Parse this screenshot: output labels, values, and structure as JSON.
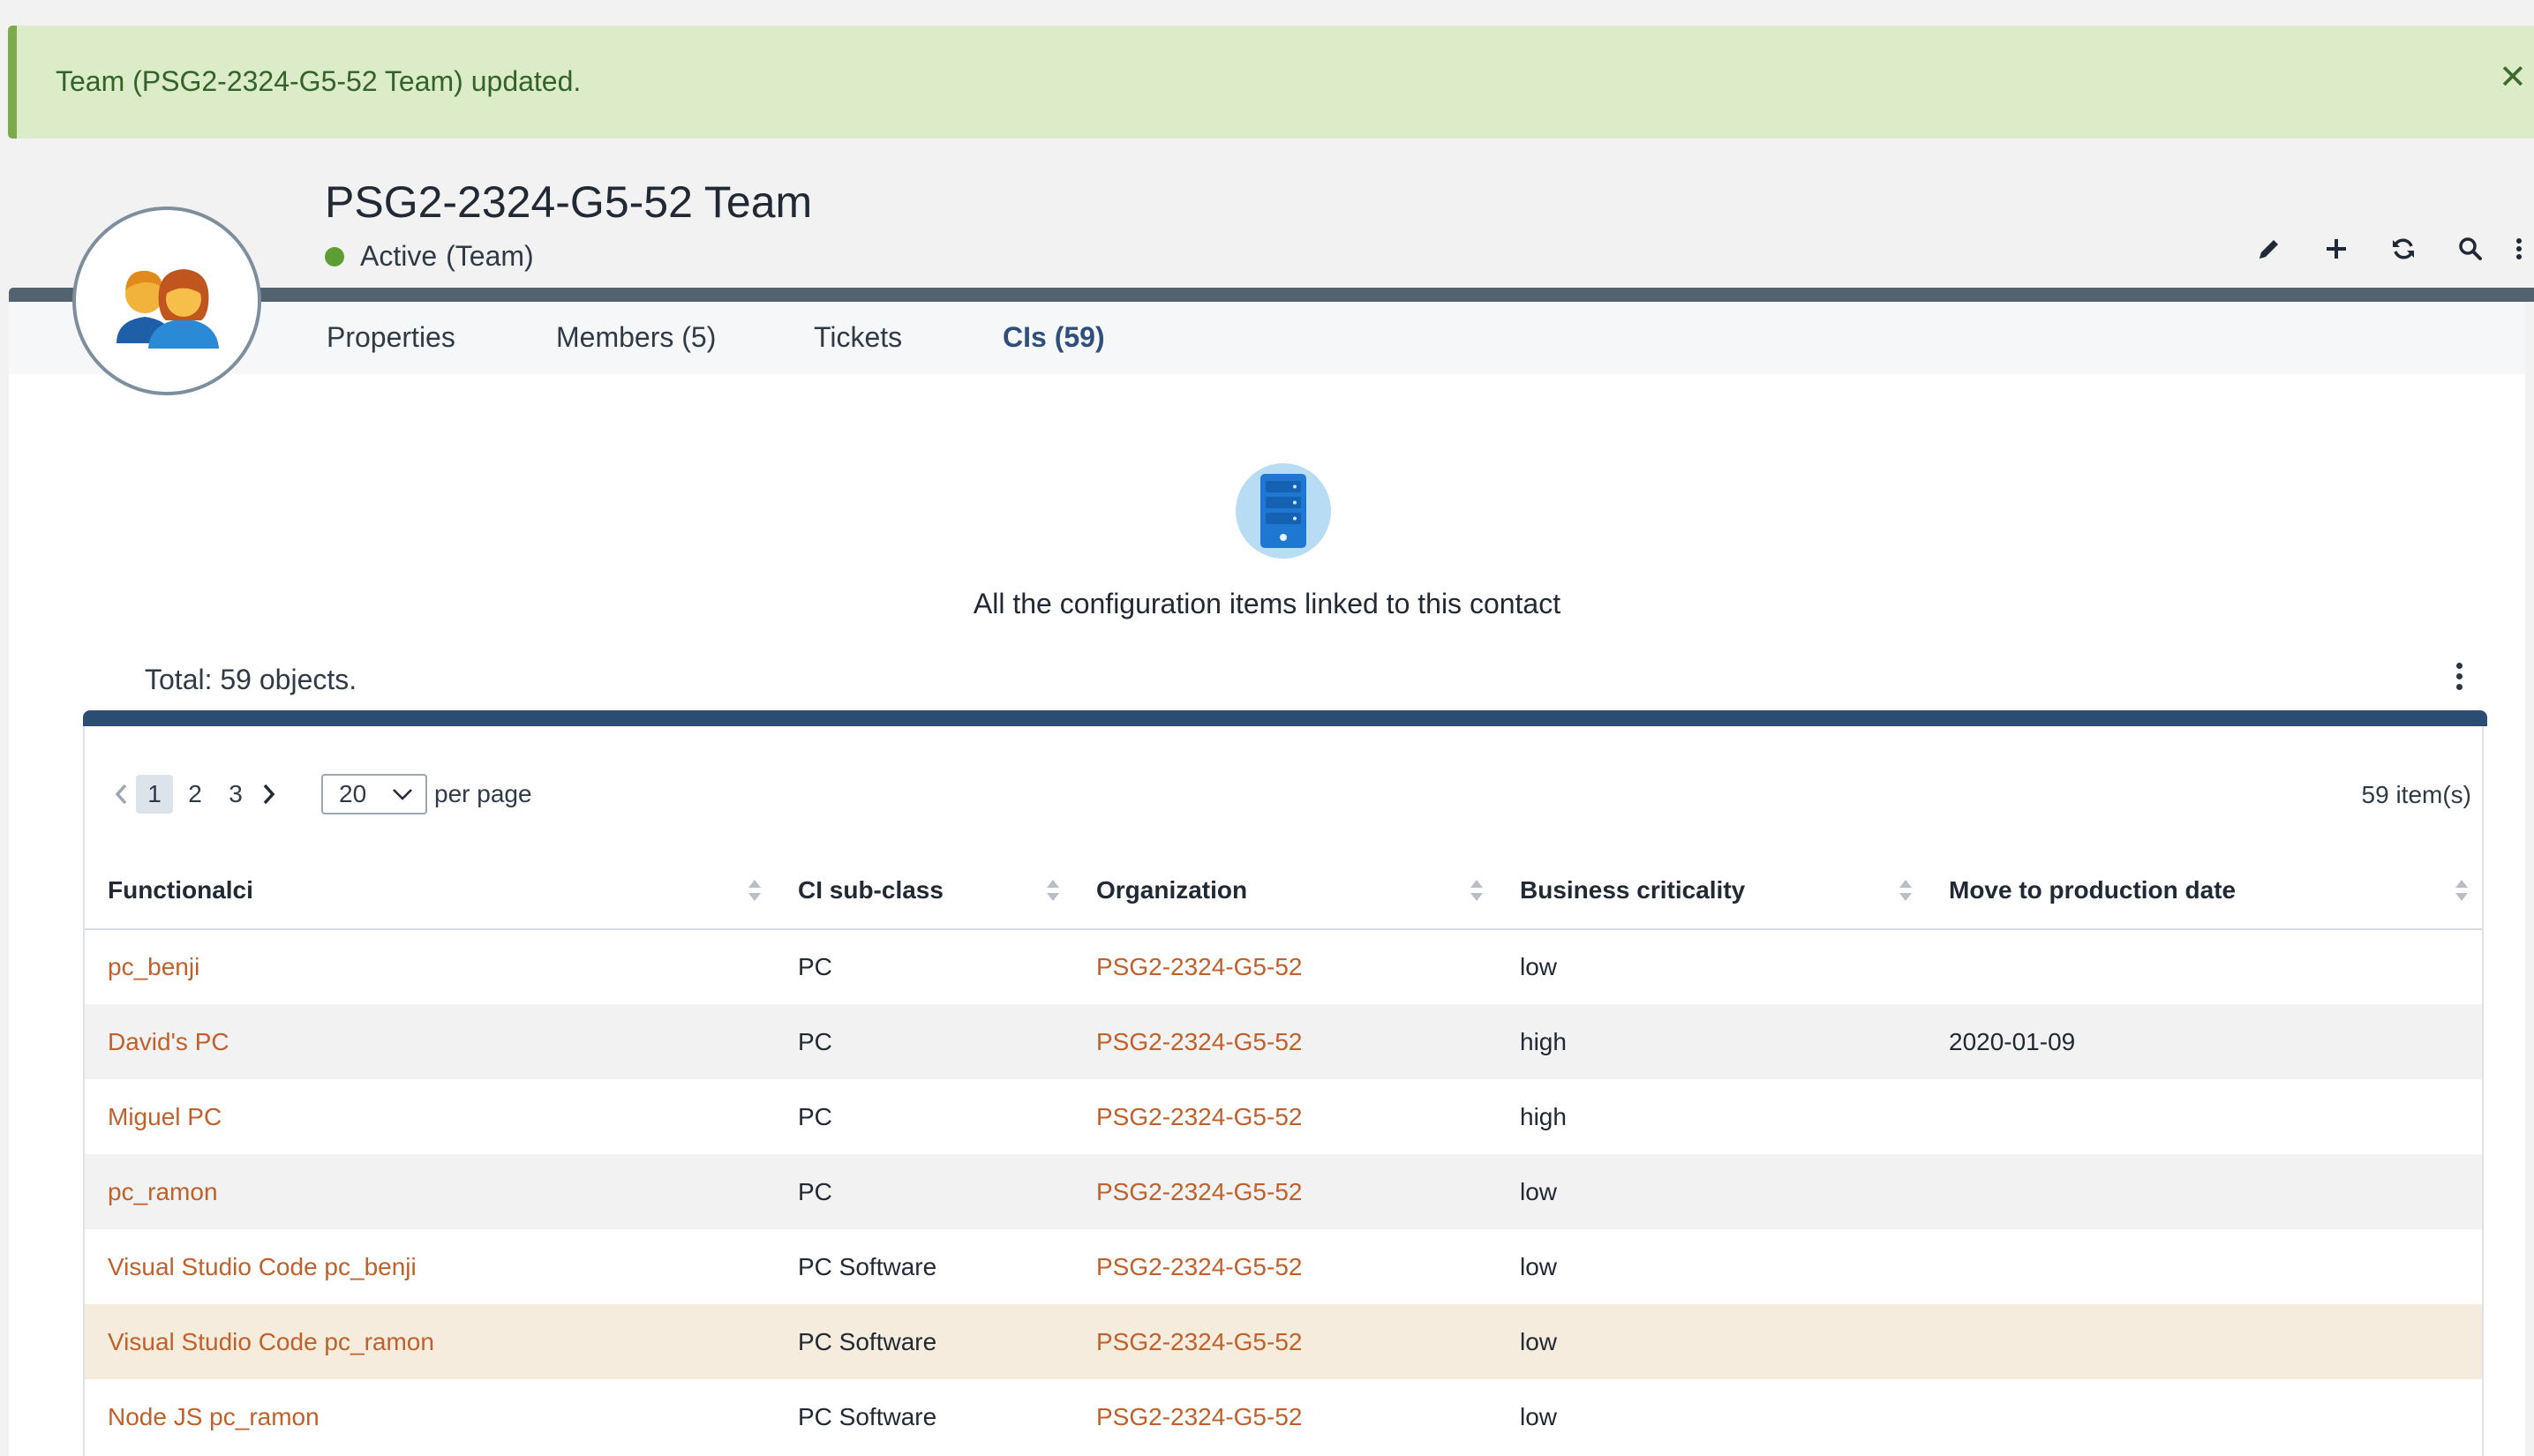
{
  "alert": {
    "message": "Team (PSG2-2324-G5-52 Team) updated.",
    "close_icon": "close-icon"
  },
  "header": {
    "title": "PSG2-2324-G5-52 Team",
    "status": "Active",
    "status_class": "(Team)",
    "status_color": "#5d9e34",
    "toolbar_icons": [
      "edit-icon",
      "add-icon",
      "refresh-icon",
      "search-icon",
      "more-vertical-icon"
    ]
  },
  "tabs": [
    {
      "label": "Properties",
      "active": false
    },
    {
      "label": "Members (5)",
      "active": false
    },
    {
      "label": "Tickets",
      "active": false
    },
    {
      "label": "CIs (59)",
      "active": true
    }
  ],
  "ci_section": {
    "icon": "server-icon",
    "description": "All the configuration items linked to this contact",
    "total": "Total: 59 objects."
  },
  "pagination": {
    "pages": [
      "1",
      "2",
      "3"
    ],
    "current": "1",
    "per_page_value": "20",
    "per_page_label": "per page",
    "item_count": "59 item(s)"
  },
  "table": {
    "columns": [
      "Functionalci",
      "CI sub-class",
      "Organization",
      "Business criticality",
      "Move to production date"
    ],
    "rows": [
      {
        "name": "pc_benji",
        "subclass": "PC",
        "org": "PSG2-2324-G5-52",
        "criticality": "low",
        "date": ""
      },
      {
        "name": "David's PC",
        "subclass": "PC",
        "org": "PSG2-2324-G5-52",
        "criticality": "high",
        "date": "2020-01-09"
      },
      {
        "name": "Miguel PC",
        "subclass": "PC",
        "org": "PSG2-2324-G5-52",
        "criticality": "high",
        "date": ""
      },
      {
        "name": "pc_ramon",
        "subclass": "PC",
        "org": "PSG2-2324-G5-52",
        "criticality": "low",
        "date": ""
      },
      {
        "name": "Visual Studio Code pc_benji",
        "subclass": "PC Software",
        "org": "PSG2-2324-G5-52",
        "criticality": "low",
        "date": ""
      },
      {
        "name": "Visual Studio Code pc_ramon",
        "subclass": "PC Software",
        "org": "PSG2-2324-G5-52",
        "criticality": "low",
        "date": ""
      },
      {
        "name": "Node JS pc_ramon",
        "subclass": "PC Software",
        "org": "PSG2-2324-G5-52",
        "criticality": "low",
        "date": ""
      }
    ]
  },
  "colors": {
    "link": "#c0602a",
    "accent_band": "#2c4d73",
    "header_band": "#52636f",
    "alert_bg": "#dcebc8"
  }
}
